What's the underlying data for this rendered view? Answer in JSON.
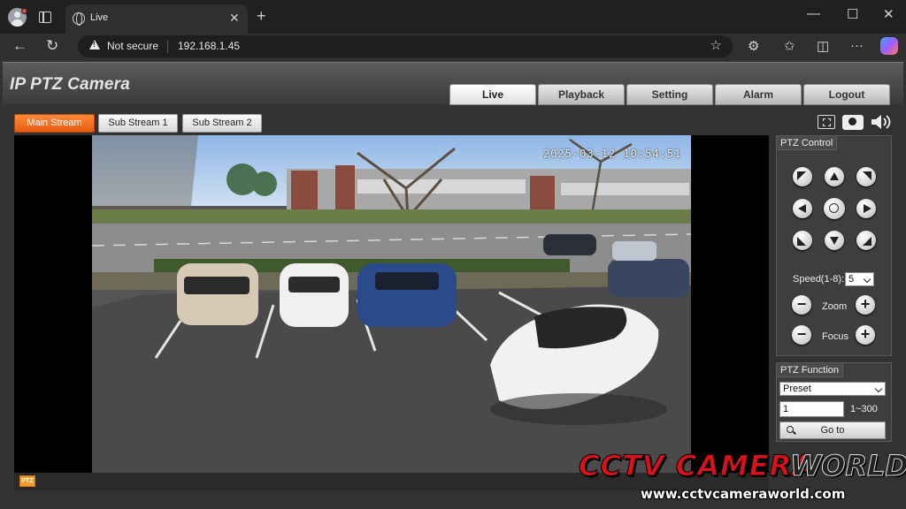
{
  "browser": {
    "tab_title": "Live",
    "tab_close": "✕",
    "new_tab": "+",
    "not_secure": "Not secure",
    "url": "192.168.1.45",
    "window_buttons": [
      "—",
      "☐",
      "✕"
    ],
    "icons": [
      "back-icon",
      "refresh-icon",
      "star-icon",
      "extensions-icon",
      "favorites-icon",
      "collections-icon",
      "more-icon",
      "copilot-icon"
    ]
  },
  "app": {
    "title": "IP PTZ Camera",
    "nav_tabs": [
      {
        "label": "Live",
        "active": true
      },
      {
        "label": "Playback",
        "active": false
      },
      {
        "label": "Setting",
        "active": false
      },
      {
        "label": "Alarm",
        "active": false
      },
      {
        "label": "Logout",
        "active": false
      }
    ],
    "streams": [
      {
        "label": "Main Stream",
        "active": true
      },
      {
        "label": "Sub Stream 1",
        "active": false
      },
      {
        "label": "Sub Stream 2",
        "active": false
      }
    ],
    "video": {
      "timestamp": "2025-03-12 10:54:51",
      "ptz_toggle": "PTZ"
    },
    "ptz_control": {
      "title": "PTZ Control",
      "speed_label": "Speed(1-8):",
      "speed_value": "5",
      "zoom_label": "Zoom",
      "focus_label": "Focus",
      "minus": "−",
      "plus": "+"
    },
    "ptz_function": {
      "title": "PTZ Function",
      "mode": "Preset",
      "preset_value": "1",
      "range": "1~300",
      "goto_label": "Go to"
    },
    "colors": {
      "accent": "#f07020",
      "panel": "#3e3e3e"
    }
  },
  "watermark": {
    "brand_main": "CCTV CAMERA",
    "brand_world": "WORLD",
    "url": "www.cctvcameraworld.com"
  }
}
